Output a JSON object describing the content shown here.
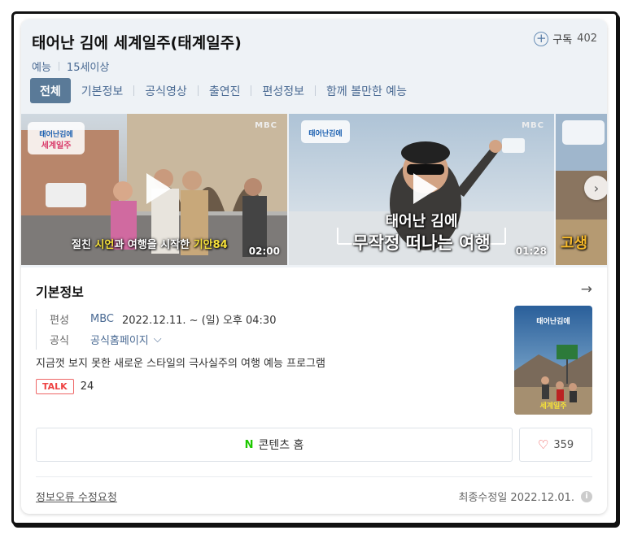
{
  "program": {
    "title": "태어난 김에 세계일주(태계일주)",
    "genre": "예능",
    "rating": "15세이상",
    "subscribe_label": "구독",
    "subscribe_count": "402"
  },
  "tabs": [
    "전체",
    "기본정보",
    "공식영상",
    "출연진",
    "편성정보",
    "함께 볼만한 예능"
  ],
  "videos": [
    {
      "duration": "02:00",
      "caption_parts": [
        "절친 ",
        "시언",
        "과 여행을 시작한 ",
        "기안84"
      ],
      "logo": "MBC"
    },
    {
      "duration": "01:28",
      "caption_line1": "태어난 김에",
      "caption_line2": "무작정 떠나는 여행",
      "logo": "MBC"
    },
    {
      "caption": "고생"
    }
  ],
  "basic_info": {
    "section_title": "기본정보",
    "schedule_label": "편성",
    "channel": "MBC",
    "schedule": "2022.12.11. ~ (일) 오후 04:30",
    "official_label": "공식",
    "official_link": "공식홈페이지",
    "description": "지금껏 보지 못한 새로운 스타일의 극사실주의 여행 예능 프로그램",
    "talk_label": "TALK",
    "talk_count": "24"
  },
  "actions": {
    "content_home": "콘텐츠 홈",
    "naver_n": "N",
    "like_count": "359"
  },
  "footer": {
    "report": "정보오류 수정요청",
    "updated": "최종수정일 2022.12.01."
  },
  "colors": {
    "header_bg": "#eef2f6",
    "tab_active": "#5a7a98",
    "link": "#4a6a93",
    "talk": "#e44444",
    "naver": "#1ec800",
    "highlight": "#f5e03a"
  }
}
